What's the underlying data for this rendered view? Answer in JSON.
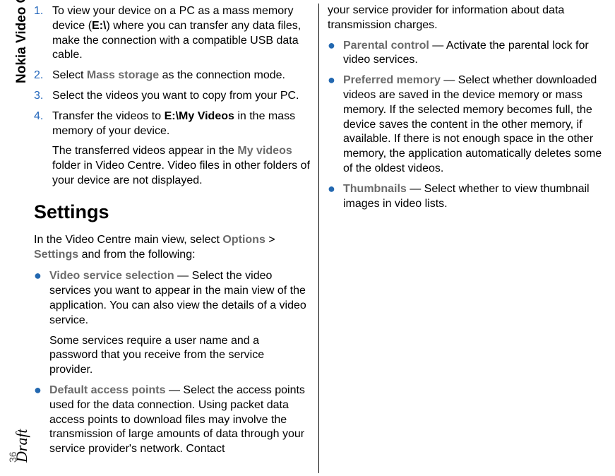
{
  "sidebar": {
    "title": "Nokia Video Centre",
    "watermark": "Draft",
    "page_number": "36"
  },
  "left_column": {
    "ordered_items": [
      {
        "num": "1.",
        "pre": "To view your device on a PC as a mass memory device (",
        "bold1": "E:\\",
        "post": ") where you can transfer any data files, make the connection with a compatible USB data cable."
      },
      {
        "num": "2.",
        "pre": "Select ",
        "gray1": "Mass storage",
        "post": " as the connection mode."
      },
      {
        "num": "3.",
        "text": "Select the videos you want to copy from your PC."
      },
      {
        "num": "4.",
        "pre": "Transfer the videos to ",
        "bold1": "E:\\My Videos",
        "post": " in the mass memory of your device.",
        "note_pre": "The transferred videos appear in the ",
        "note_gray": "My videos",
        "note_post": " folder in Video Centre. Video files in other folders of your device are not displayed."
      }
    ],
    "settings_heading": "Settings",
    "settings_intro_pre": "In the Video Centre main view, select ",
    "settings_intro_gray1": "Options",
    "settings_intro_mid": " > ",
    "settings_intro_gray2": "Settings",
    "settings_intro_post": " and from the following:",
    "bullets": [
      {
        "label": "Video service selection",
        "text": " — Select the video services you want to appear in the main view of the application. You can also view the details of a video service.",
        "note": "Some services require a user name and a password that you receive from the service provider."
      },
      {
        "label": "Default access points",
        "text": " — Select the access points used for the data connection. Using packet data access points to download files may involve the transmission of large amounts of data through your service provider's network. Contact"
      }
    ]
  },
  "right_column": {
    "continuation": "your service provider for information about data transmission charges.",
    "bullets": [
      {
        "label": "Parental control",
        "text": " — Activate the parental lock for video services."
      },
      {
        "label": "Preferred memory",
        "text": " — Select whether downloaded videos are saved in the device memory or mass memory. If the selected memory becomes full, the device saves the content in the other memory, if available. If there is not enough space in the other memory, the application automatically deletes some of the oldest videos."
      },
      {
        "label": "Thumbnails",
        "text": " — Select whether to view thumbnail images in video lists."
      }
    ]
  }
}
